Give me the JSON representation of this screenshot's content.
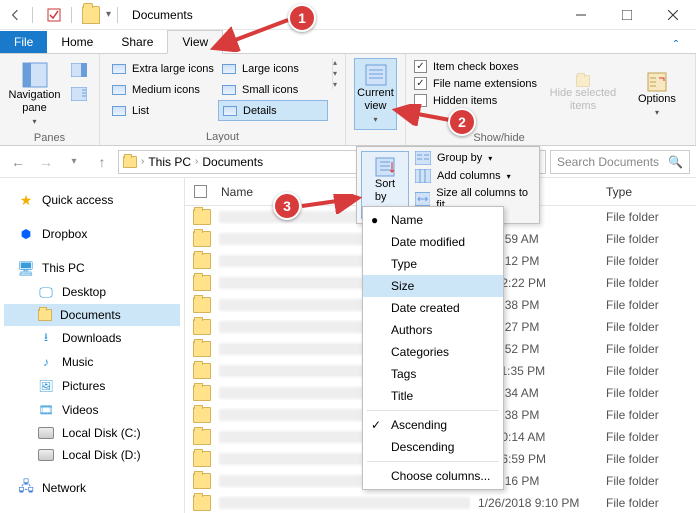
{
  "window": {
    "title": "Documents"
  },
  "tabs": {
    "file": "File",
    "home": "Home",
    "share": "Share",
    "view": "View"
  },
  "ribbon": {
    "panes": {
      "big": "Navigation\npane",
      "label": "Panes"
    },
    "layout": {
      "xl": "Extra large icons",
      "large": "Large icons",
      "medium": "Medium icons",
      "small": "Small icons",
      "list": "List",
      "details": "Details",
      "label": "Layout"
    },
    "currentview": {
      "big": "Current\nview",
      "label": "Current view"
    },
    "showhide": {
      "check_boxes": "Item check boxes",
      "extensions": "File name extensions",
      "hidden": "Hidden items",
      "hide_selected": "Hide selected\nitems",
      "label": "Show/hide"
    },
    "options": "Options"
  },
  "address": {
    "crumbs": [
      "This PC",
      "Documents"
    ],
    "search_placeholder": "Search Documents"
  },
  "sidebar": {
    "quick_access": "Quick access",
    "dropbox": "Dropbox",
    "this_pc": "This PC",
    "desktop": "Desktop",
    "documents": "Documents",
    "downloads": "Downloads",
    "music": "Music",
    "pictures": "Pictures",
    "videos": "Videos",
    "local_c": "Local Disk (C:)",
    "local_d": "Local Disk (D:)",
    "network": "Network"
  },
  "columns": {
    "name": "Name",
    "date": "Date modified",
    "type": "Type"
  },
  "rows": [
    {
      "date": "",
      "type": "File folder"
    },
    {
      "date": "18 9:59 AM",
      "type": "File folder"
    },
    {
      "date": "16 6:12 PM",
      "type": "File folder"
    },
    {
      "date": "16 12:22 PM",
      "type": "File folder"
    },
    {
      "date": "18 3:38 PM",
      "type": "File folder"
    },
    {
      "date": "17 5:27 PM",
      "type": "File folder"
    },
    {
      "date": "17 9:52 PM",
      "type": "File folder"
    },
    {
      "date": "16 11:35 PM",
      "type": "File folder"
    },
    {
      "date": "16 9:34 AM",
      "type": "File folder"
    },
    {
      "date": "18 3:38 PM",
      "type": "File folder"
    },
    {
      "date": "18 10:14 AM",
      "type": "File folder"
    },
    {
      "date": "016 6:59 PM",
      "type": "File folder"
    },
    {
      "date": "18 2:16 PM",
      "type": "File folder"
    },
    {
      "date": "1/26/2018 9:10 PM",
      "type": "File folder"
    }
  ],
  "cvpanel": {
    "sort": "Sort\nby",
    "group": "Group by",
    "addcol": "Add columns",
    "sizeall": "Size all columns to fit"
  },
  "sortmenu": {
    "name": "Name",
    "datemod": "Date modified",
    "type": "Type",
    "size": "Size",
    "datecreated": "Date created",
    "authors": "Authors",
    "categories": "Categories",
    "tags": "Tags",
    "title": "Title",
    "asc": "Ascending",
    "desc": "Descending",
    "choose": "Choose columns..."
  },
  "callouts": {
    "c1": "1",
    "c2": "2",
    "c3": "3"
  }
}
